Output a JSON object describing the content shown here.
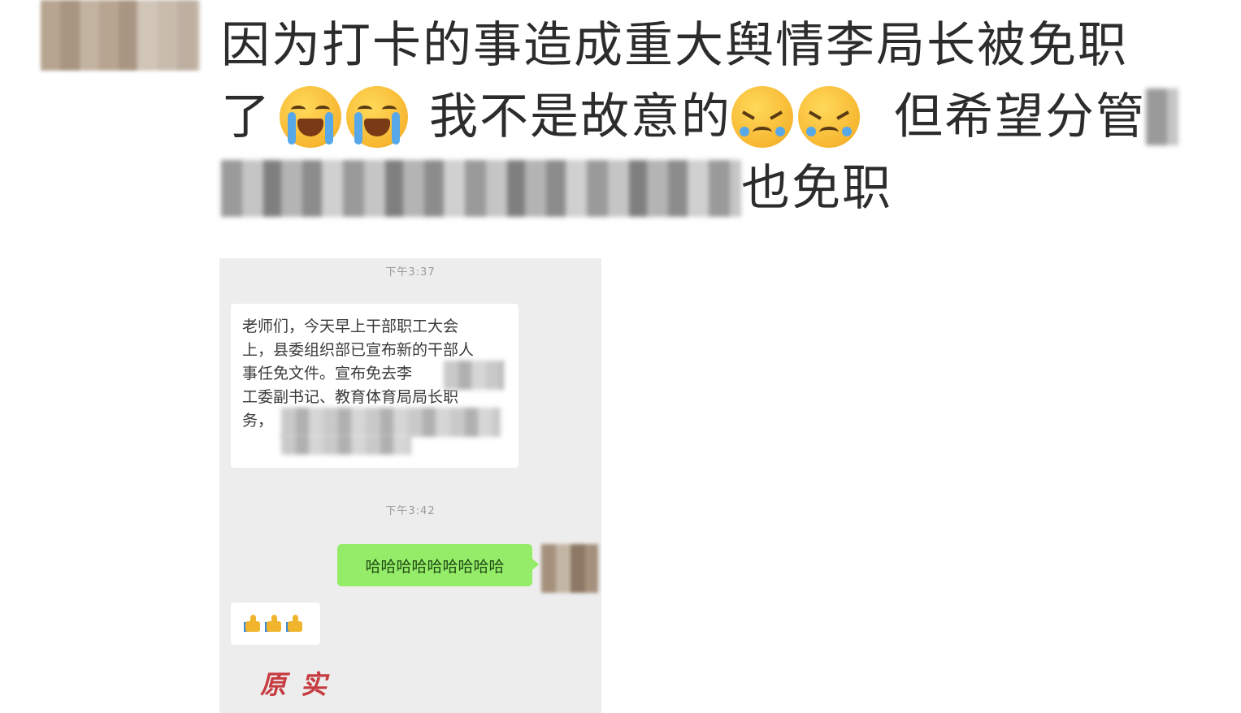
{
  "post": {
    "line1": "因为打卡的事造成重大舆情李局长被免职",
    "line2_a": "了",
    "line2_b": "我不是故意的",
    "line2_c": "但希望分管",
    "line3_end": "也免职",
    "emojis": [
      "loudly-crying-face",
      "loudly-crying-face",
      "angry-crying-face",
      "angry-crying-face"
    ]
  },
  "chat": {
    "timestamp_1": "下午3:37",
    "notice_text": "老师们，今天早上干部职工大会\n上，县委组织部已宣布新的干部人\n事任免文件。宣布免去李\n工委副书记、教育体育局局长职\n务，",
    "timestamp_2": "下午3:42",
    "reply_text": "哈哈哈哈哈哈哈哈哈",
    "thumbs_emoji": "thumbs-up",
    "thumbs_count": 3,
    "bubble_colors": {
      "incoming": "#ffffff",
      "outgoing": "#95ec69",
      "background": "#ededed"
    }
  },
  "seal_text": "原实"
}
